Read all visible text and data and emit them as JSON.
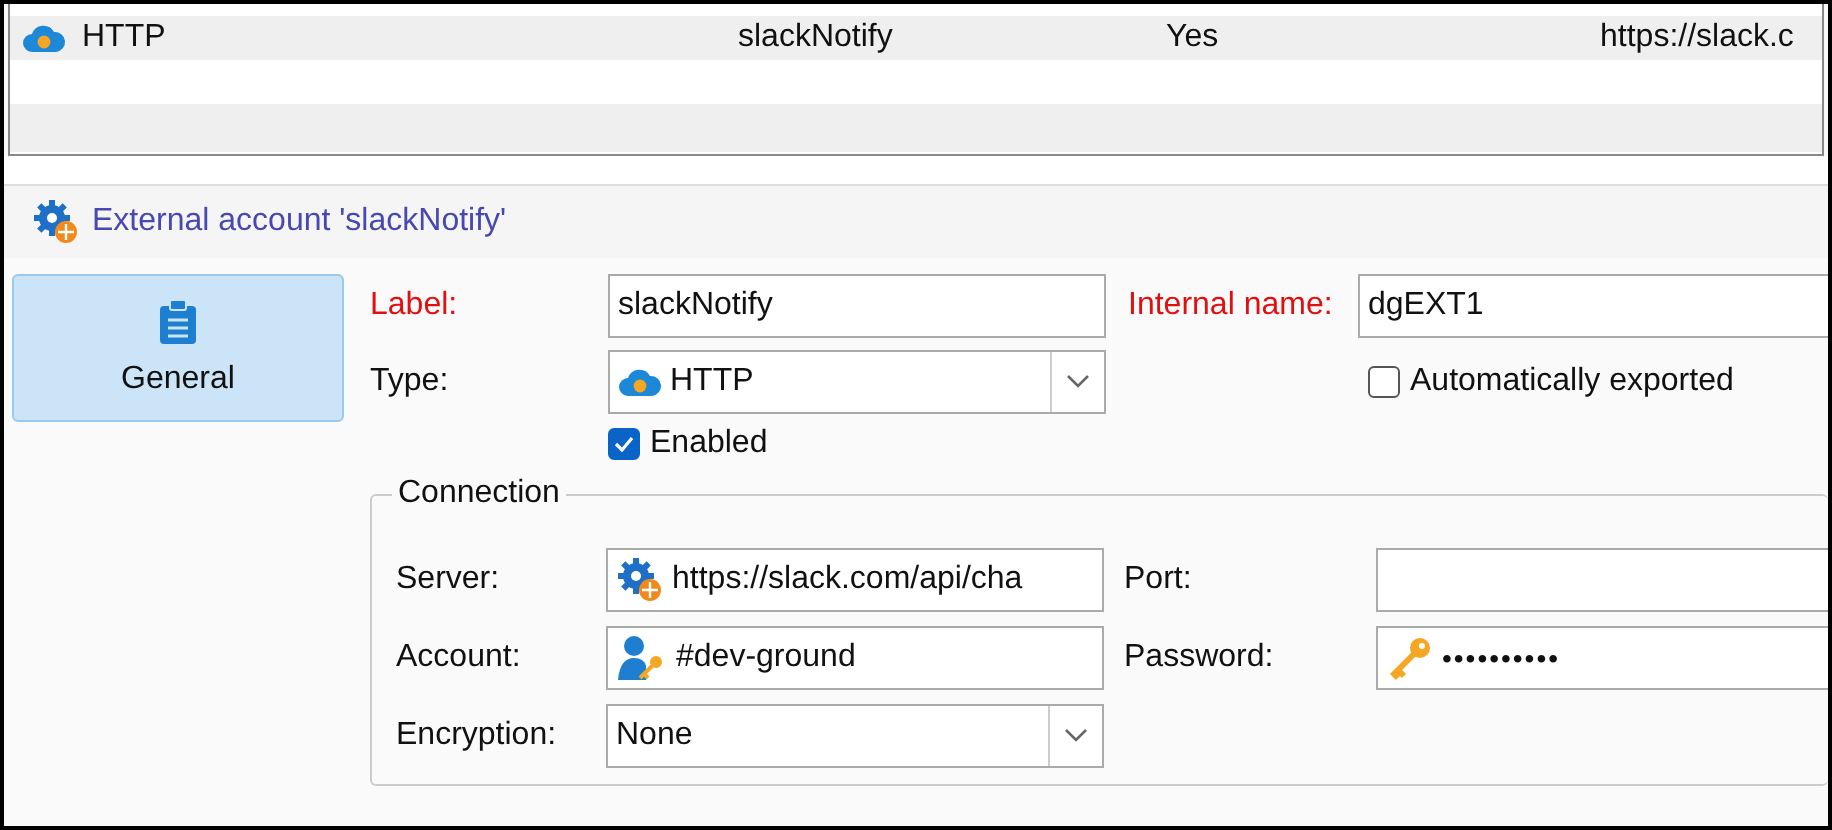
{
  "list": {
    "rows": [
      {
        "kind": "http",
        "cells": [
          "HTTP",
          "slackNotify",
          "Yes",
          "https://slack.c"
        ]
      }
    ]
  },
  "header": {
    "title": "External account 'slackNotify'"
  },
  "sidebar": {
    "items": [
      {
        "label": "General",
        "selected": true
      }
    ]
  },
  "form": {
    "label": {
      "label": "Label:",
      "required": true,
      "value": "slackNotify"
    },
    "internal_name": {
      "label": "Internal name:",
      "required": true,
      "value": "dgEXT1"
    },
    "type": {
      "label": "Type:",
      "value": "HTTP"
    },
    "auto_exported": {
      "label": "Automatically exported",
      "checked": false
    },
    "enabled": {
      "label": "Enabled",
      "checked": true
    },
    "connection": {
      "title": "Connection",
      "server": {
        "label": "Server:",
        "value": "https://slack.com/api/cha"
      },
      "port": {
        "label": "Port:"
      },
      "account": {
        "label": "Account:",
        "value": "#dev-ground"
      },
      "password": {
        "label": "Password:",
        "value": "••••••••••"
      },
      "encryption": {
        "label": "Encryption:",
        "value": "None"
      }
    }
  }
}
